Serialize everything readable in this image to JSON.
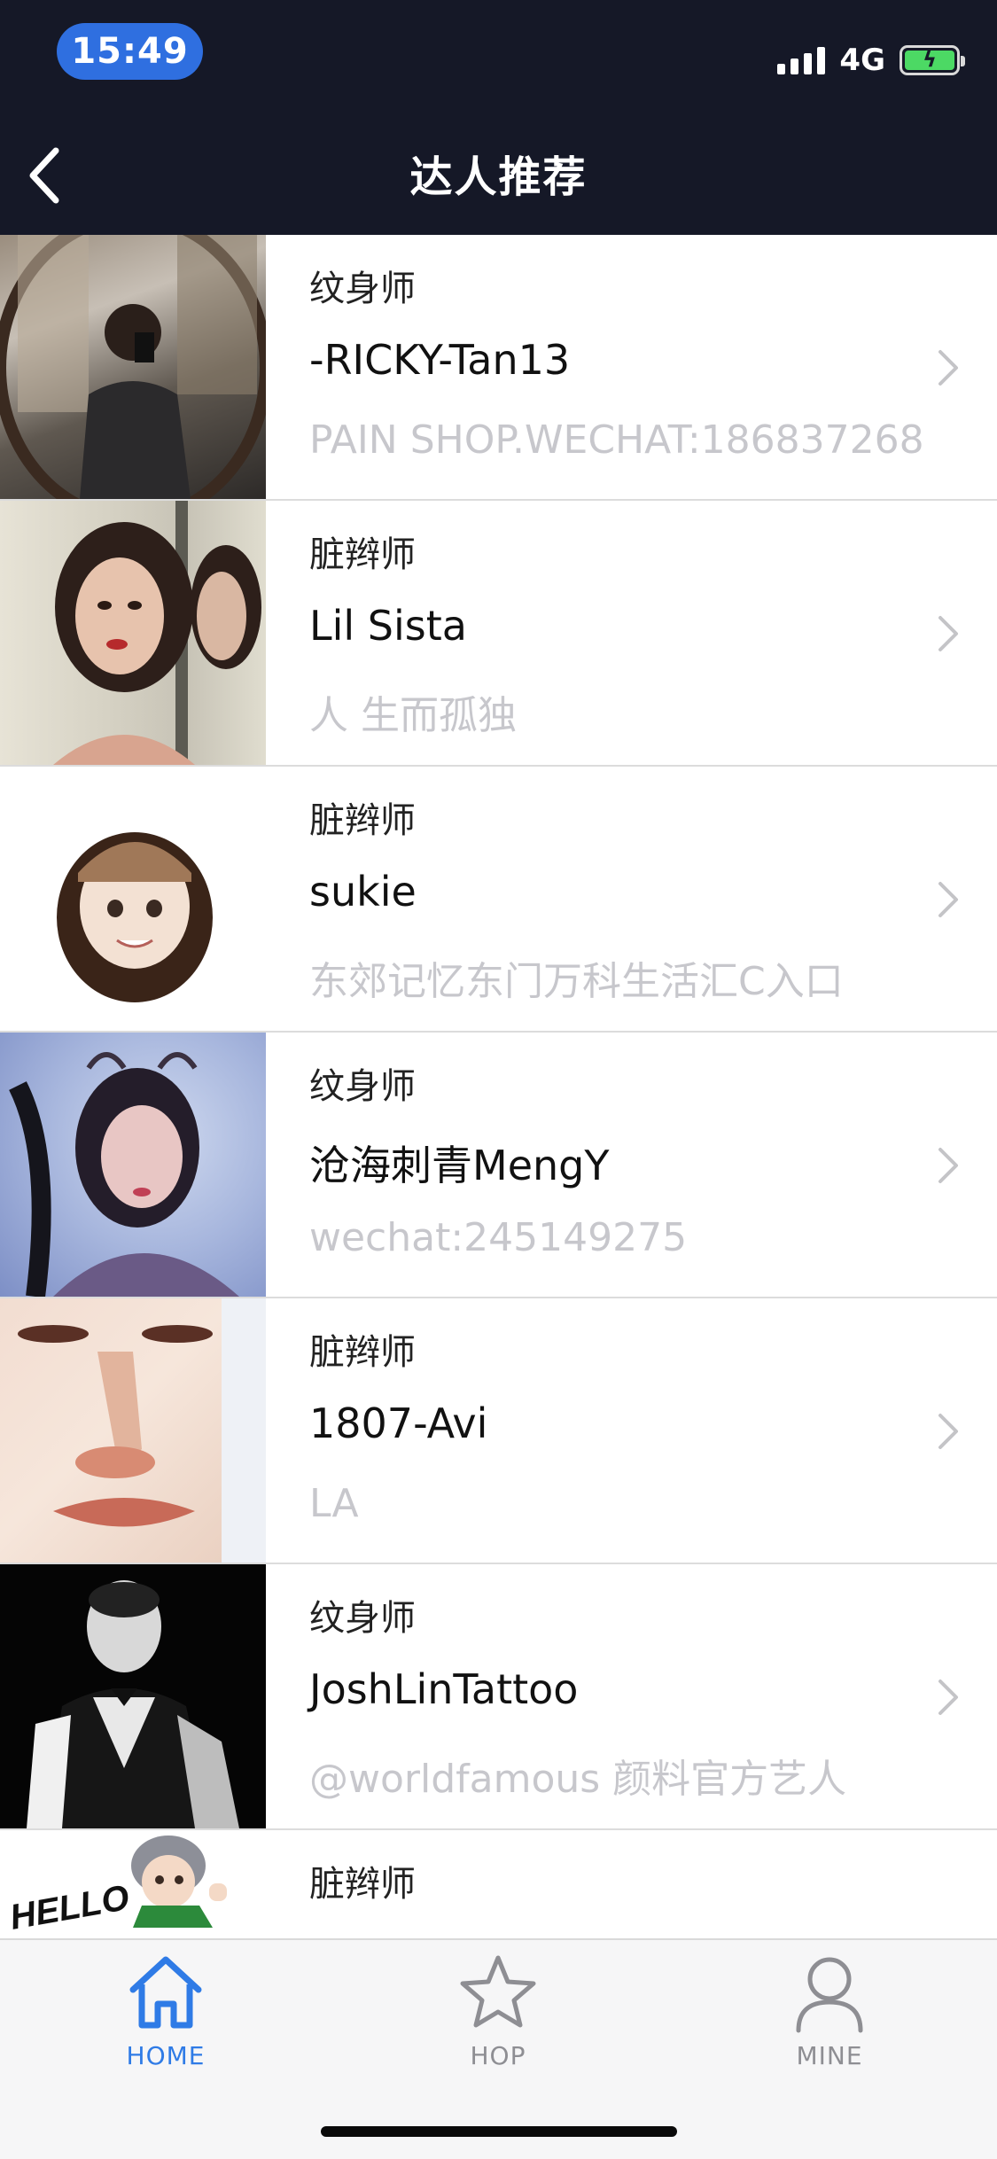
{
  "status_bar": {
    "time": "15:49",
    "network": "4G",
    "battery_charging": true,
    "signal_bars": 4
  },
  "nav": {
    "title": "达人推荐",
    "back_icon": "chevron-left-icon"
  },
  "list": [
    {
      "role": "纹身师",
      "name": "-RICKY-Tan13",
      "desc": "PAIN SHOP.WECHAT:186837268"
    },
    {
      "role": "脏辫师",
      "name": "Lil Sista",
      "desc": "人 生而孤独"
    },
    {
      "role": "脏辫师",
      "name": "sukie",
      "desc": "东郊记忆东门万科生活汇C入口"
    },
    {
      "role": "纹身师",
      "name": "沧海刺青MengY",
      "desc": "wechat:245149275"
    },
    {
      "role": "脏辫师",
      "name": "1807-Avi",
      "desc": "LA"
    },
    {
      "role": "纹身师",
      "name": "JoshLinTattoo",
      "desc": "@worldfamous 颜料官方艺人"
    },
    {
      "role": "脏辫师",
      "name": "",
      "desc": "",
      "thumb_text": "HELLO"
    }
  ],
  "tabbar": {
    "tabs": [
      {
        "label": "HOME",
        "icon": "home-icon",
        "active": true
      },
      {
        "label": "HOP",
        "icon": "star-icon",
        "active": false
      },
      {
        "label": "MINE",
        "icon": "person-icon",
        "active": false
      }
    ]
  },
  "colors": {
    "nav_bg": "#151827",
    "accent": "#2f7be6",
    "time_pill": "#2f6fe0",
    "muted_text": "#c7c7cc",
    "tab_inactive": "#8e8e93"
  }
}
